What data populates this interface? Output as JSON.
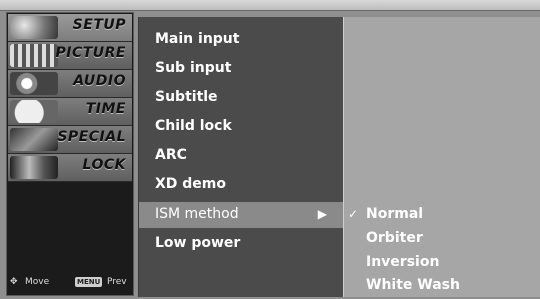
{
  "tabs": [
    {
      "label": "SETUP",
      "icon": "setup-thumbnail"
    },
    {
      "label": "PICTURE",
      "icon": "picture-thumbnail"
    },
    {
      "label": "AUDIO",
      "icon": "audio-thumbnail"
    },
    {
      "label": "TIME",
      "icon": "time-thumbnail"
    },
    {
      "label": "SPECIAL",
      "icon": "special-thumbnail"
    },
    {
      "label": "LOCK",
      "icon": "lock-thumbnail"
    }
  ],
  "nav_hint": {
    "move": "Move",
    "menu_badge": "MENU",
    "prev": "Prev"
  },
  "menu": {
    "items": [
      {
        "label": "Main input"
      },
      {
        "label": "Sub input"
      },
      {
        "label": "Subtitle"
      },
      {
        "label": "Child lock"
      },
      {
        "label": "ARC"
      },
      {
        "label": "XD demo"
      },
      {
        "label": "ISM method",
        "arrow": "▶",
        "selected": true
      },
      {
        "label": "Low power"
      }
    ]
  },
  "submenu": {
    "items": [
      {
        "label": "Normal",
        "checked": true,
        "check_mark": "✓"
      },
      {
        "label": "Orbiter"
      },
      {
        "label": "Inversion"
      },
      {
        "label": "White Wash"
      }
    ]
  },
  "colors": {
    "menu_bg": "#4b4b4b",
    "submenu_bg": "#a6a6a6",
    "selected_bg": "#8a8a8a",
    "tab_column_bg": "#1b1b1b"
  }
}
